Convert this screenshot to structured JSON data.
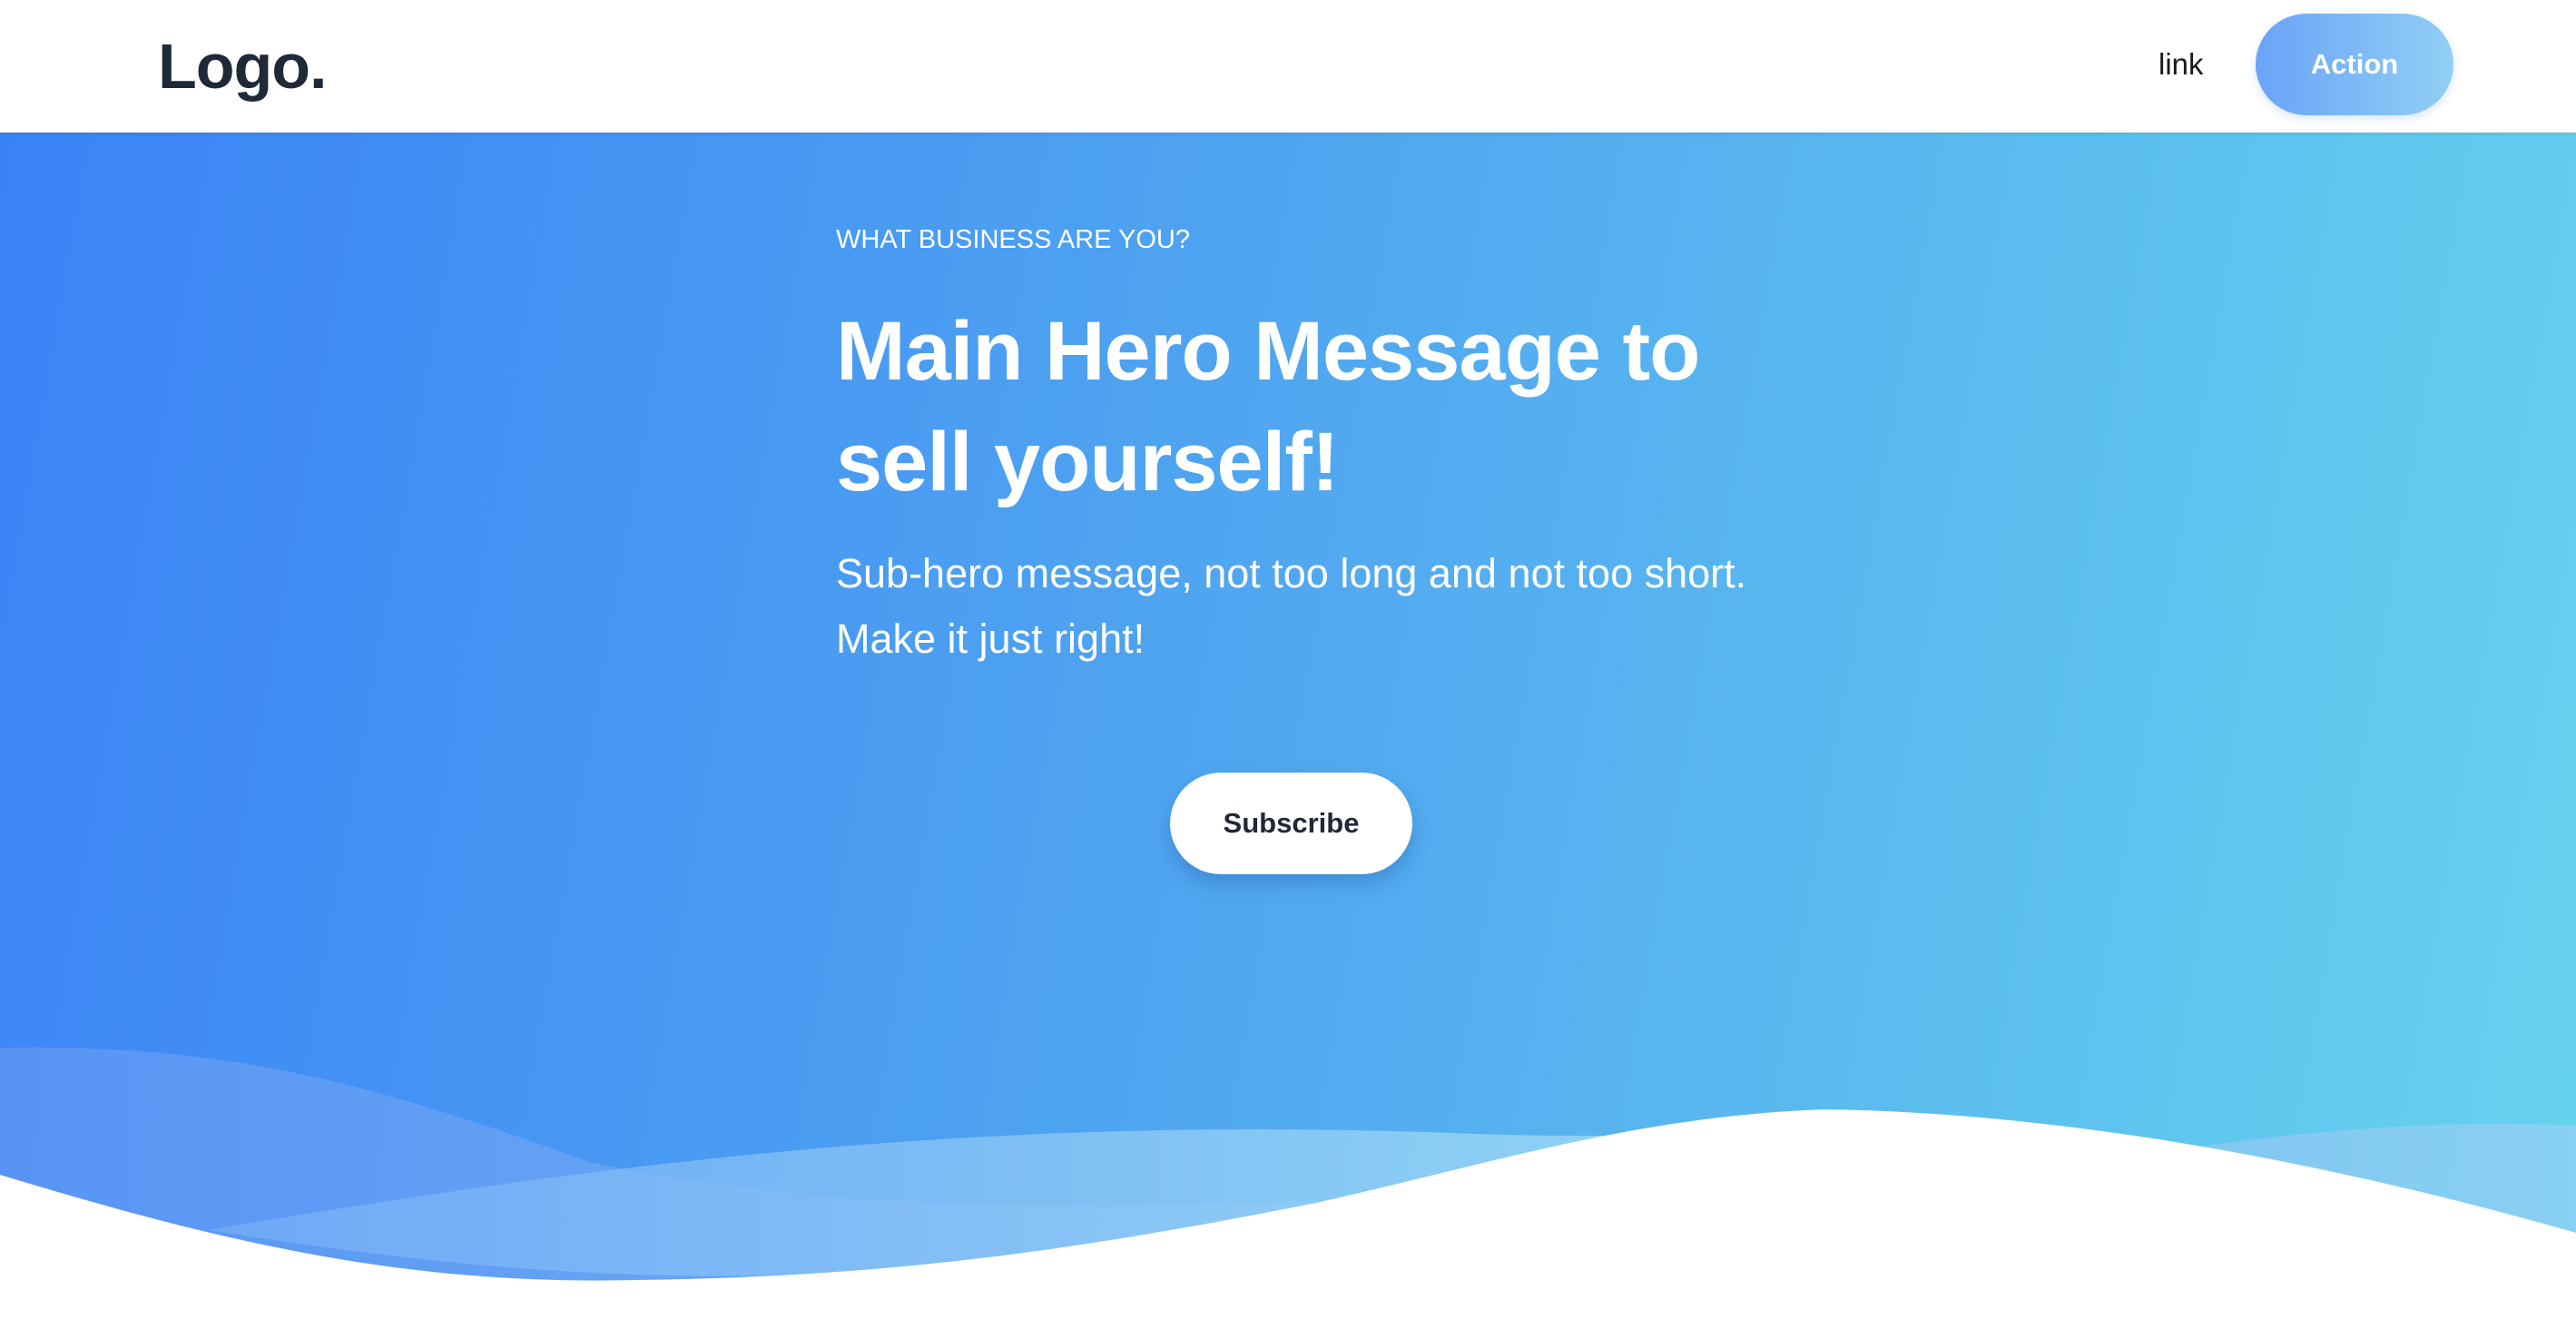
{
  "nav": {
    "logo": "Logo.",
    "link_label": "link",
    "action_label": "Action"
  },
  "hero": {
    "eyebrow": "WHAT BUSINESS ARE YOU?",
    "title": "Main Hero Message to sell yourself!",
    "subtitle": "Sub-hero message, not too long and not too short. Make it just right!",
    "cta_label": "Subscribe"
  },
  "colors": {
    "hero_gradient_start": "#3a83f6",
    "hero_gradient_end": "#66d3ee",
    "action_gradient_start": "#6aa3f8",
    "action_gradient_end": "#92cff4",
    "logo_text": "#1f2937"
  }
}
